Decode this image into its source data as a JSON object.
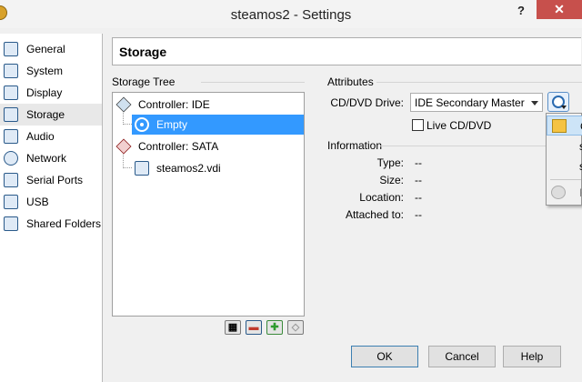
{
  "window": {
    "title": "steamos2 - Settings",
    "help_label": "?",
    "close_label": "✕"
  },
  "sidebar": {
    "items": [
      {
        "label": "General",
        "icon": "general-icon"
      },
      {
        "label": "System",
        "icon": "system-icon"
      },
      {
        "label": "Display",
        "icon": "display-icon"
      },
      {
        "label": "Storage",
        "icon": "storage-icon",
        "selected": true
      },
      {
        "label": "Audio",
        "icon": "audio-icon"
      },
      {
        "label": "Network",
        "icon": "network-icon"
      },
      {
        "label": "Serial Ports",
        "icon": "serial-ports-icon"
      },
      {
        "label": "USB",
        "icon": "usb-icon"
      },
      {
        "label": "Shared Folders",
        "icon": "shared-folders-icon"
      }
    ]
  },
  "page": {
    "title": "Storage"
  },
  "storage_tree": {
    "label": "Storage Tree",
    "nodes": [
      {
        "label": "Controller: IDE",
        "kind": "controller"
      },
      {
        "label": "Empty",
        "kind": "optical",
        "selected": true
      },
      {
        "label": "Controller: SATA",
        "kind": "controller"
      },
      {
        "label": "steamos2.vdi",
        "kind": "disk"
      }
    ],
    "toolbar": [
      "add-controller-icon",
      "remove-controller-icon",
      "add-attachment-icon",
      "remove-attachment-icon"
    ]
  },
  "attributes": {
    "label": "Attributes",
    "cd_dvd_drive_label": "CD/DVD Drive:",
    "cd_dvd_drive_value": "IDE Secondary Master",
    "live_cd_label": "Live CD/DVD",
    "live_cd_checked": false
  },
  "information": {
    "label": "Information",
    "rows": [
      {
        "label": "Type:",
        "value": "--"
      },
      {
        "label": "Size:",
        "value": "--"
      },
      {
        "label": "Location:",
        "value": "--"
      },
      {
        "label": "Attached to:",
        "value": "--"
      }
    ]
  },
  "disc_menu": {
    "items": [
      {
        "label": "C",
        "icon": "folder-icon",
        "highlighted": true
      },
      {
        "label": "s",
        "icon": ""
      },
      {
        "label": "s",
        "icon": ""
      },
      {
        "label": "R",
        "icon": "remove-disk-icon",
        "disabled": true
      }
    ]
  },
  "buttons": {
    "ok": "OK",
    "cancel": "Cancel",
    "help": "Help"
  },
  "colors": {
    "selection": "#3399ff",
    "close_button": "#c7504c",
    "dialog_background": "#f0f0f0"
  }
}
